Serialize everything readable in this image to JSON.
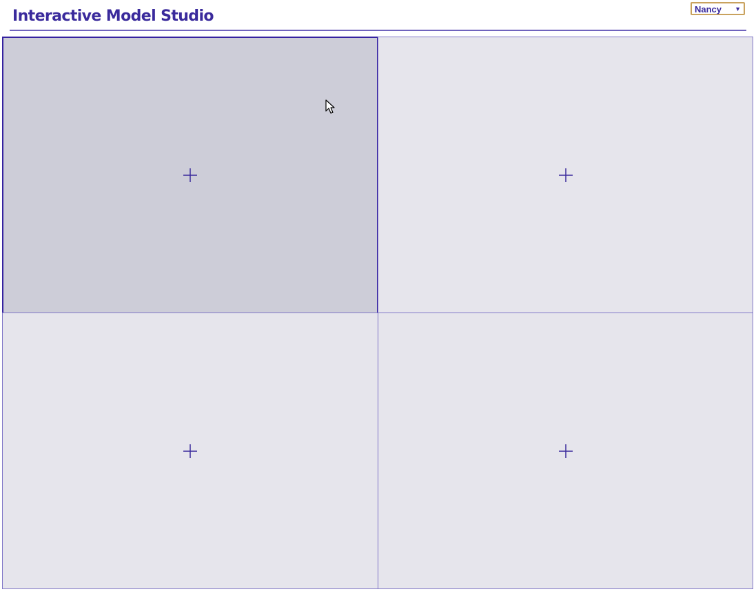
{
  "header": {
    "title": "Interactive Model Studio",
    "user_select": {
      "selected": "Nancy",
      "arrow_icon": "triangle-down-icon"
    }
  },
  "grid": {
    "panels": [
      {
        "id": "top-left",
        "state": "selected",
        "icon": "plus-icon"
      },
      {
        "id": "top-right",
        "state": "empty",
        "icon": "plus-icon"
      },
      {
        "id": "bottom-left",
        "state": "empty",
        "icon": "plus-icon"
      },
      {
        "id": "bottom-right",
        "state": "empty",
        "icon": "plus-icon"
      }
    ]
  },
  "colors": {
    "accent": "#3a2a9c",
    "panel_background": "#e6e5ec",
    "panel_selected_background": "#cdcdd8",
    "panel_border": "#7f75c7",
    "select_border": "#c9a25e"
  }
}
